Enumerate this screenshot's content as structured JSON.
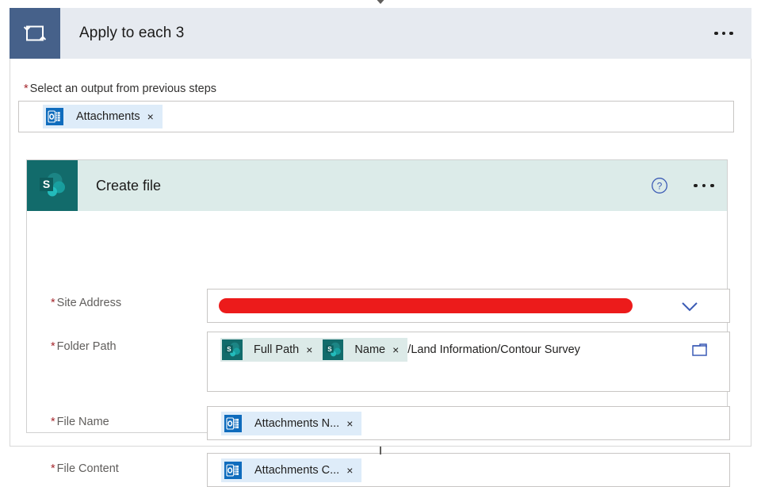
{
  "loop": {
    "title": "Apply to each 3",
    "icon": "loop-repeat-icon",
    "menu_icon": "ellipsis-menu-icon",
    "output_field": {
      "label": "Select an output from previous steps",
      "required": true,
      "token": {
        "label": "Attachments",
        "icon": "outlook-icon",
        "remove": "×"
      }
    }
  },
  "action": {
    "title": "Create file",
    "icon": "sharepoint-icon",
    "help_icon": "help-circle-icon",
    "menu_icon": "ellipsis-menu-icon",
    "fields": [
      {
        "label": "Site Address",
        "required": true,
        "kind": "redacted-dropdown",
        "value": "",
        "dropdown_icon": "chevron-down-icon"
      },
      {
        "label": "Folder Path",
        "required": true,
        "kind": "token-text",
        "tokens": [
          {
            "label": "Full Path",
            "icon": "sharepoint-icon",
            "remove": "×"
          },
          {
            "label": "Name",
            "icon": "sharepoint-icon",
            "remove": "×"
          }
        ],
        "text": "/Land Information/Contour Survey",
        "picker_icon": "folder-picker-icon"
      },
      {
        "label": "File Name",
        "required": true,
        "kind": "token",
        "token": {
          "label": "Attachments N...",
          "icon": "outlook-icon",
          "remove": "×"
        }
      },
      {
        "label": "File Content",
        "required": true,
        "kind": "token",
        "token": {
          "label": "Attachments C...",
          "icon": "outlook-icon",
          "remove": "×"
        }
      }
    ]
  },
  "colors": {
    "loop_header_bg": "#e6eaf0",
    "loop_icon_bg": "#46618a",
    "action_header_bg": "#dcebe9",
    "sharepoint_teal": "#126b6b",
    "outlook_blue": "#0f6cbd",
    "token_blue_bg": "#deecf9",
    "token_teal_bg": "#dceae8",
    "required_red": "#a4262c",
    "redaction_red": "#ec1b1b",
    "accent_blue": "#3b5bb5"
  },
  "marks": {
    "required_star": "*",
    "separator": ""
  }
}
